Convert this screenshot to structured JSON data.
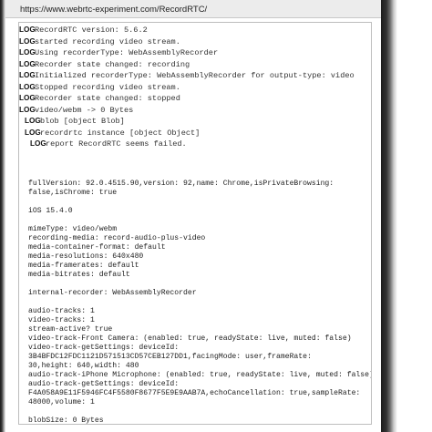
{
  "browser": {
    "url": "https://www.webrtc-experiment.com/RecordRTC/"
  },
  "logs": [
    {
      "tag": "LOG",
      "text": "RecordRTC version:  5.6.2",
      "indent": 0
    },
    {
      "tag": "LOG",
      "text": "started recording video stream.",
      "indent": 0
    },
    {
      "tag": "LOG",
      "text": "Using recorderType: WebAssemblyRecorder",
      "indent": 0
    },
    {
      "tag": "LOG",
      "text": "Recorder state changed: recording",
      "indent": 0
    },
    {
      "tag": "LOG",
      "text": "Initialized recorderType: WebAssemblyRecorder for output-type: video",
      "indent": 0
    },
    {
      "tag": "LOG",
      "text": "Stopped recording video stream.",
      "indent": 0
    },
    {
      "tag": "LOG",
      "text": "Recorder state changed: stopped",
      "indent": 0
    },
    {
      "tag": "LOG",
      "text": "video/webm -> 0 Bytes",
      "indent": 0
    },
    {
      "tag": "LOG",
      "text": "blob [object Blob]",
      "indent": 1
    },
    {
      "tag": "LOG",
      "text": "recordrtc instance [object Object]",
      "indent": 1
    },
    {
      "tag": "LOG",
      "text": "report RecordRTC seems failed.",
      "indent": 2
    }
  ],
  "info_lines": [
    "fullVersion: 92.0.4515.90,version: 92,name: Chrome,isPrivateBrowsing:",
    "false,isChrome: true",
    "",
    "iOS 15.4.0",
    "",
    "mimeType: video/webm",
    "recording-media: record-audio-plus-video",
    "media-container-format: default",
    "media-resolutions: 640x480",
    "media-framerates: default",
    "media-bitrates: default",
    "",
    "internal-recorder: WebAssemblyRecorder",
    "",
    "audio-tracks: 1",
    "video-tracks: 1",
    "stream-active? true",
    "video-track-Front Camera: (enabled: true, readyState: live, muted: false)",
    "video-track-getSettings: deviceId:",
    "3B4BFDC12FDC1121D571513CD57CEB127DD1,facingMode: user,frameRate:",
    "30,height: 640,width: 480",
    "audio-track-iPhone Microphone: (enabled: true, readyState: live, muted: false)",
    "audio-track-getSettings: deviceId:",
    "F4A058A9E11F5946FC4F5580F8677F5E9E9AAB7A,echoCancellation: true,sampleRate:",
    "48000,volume: 1",
    "",
    "blobSize: 0 Bytes"
  ]
}
